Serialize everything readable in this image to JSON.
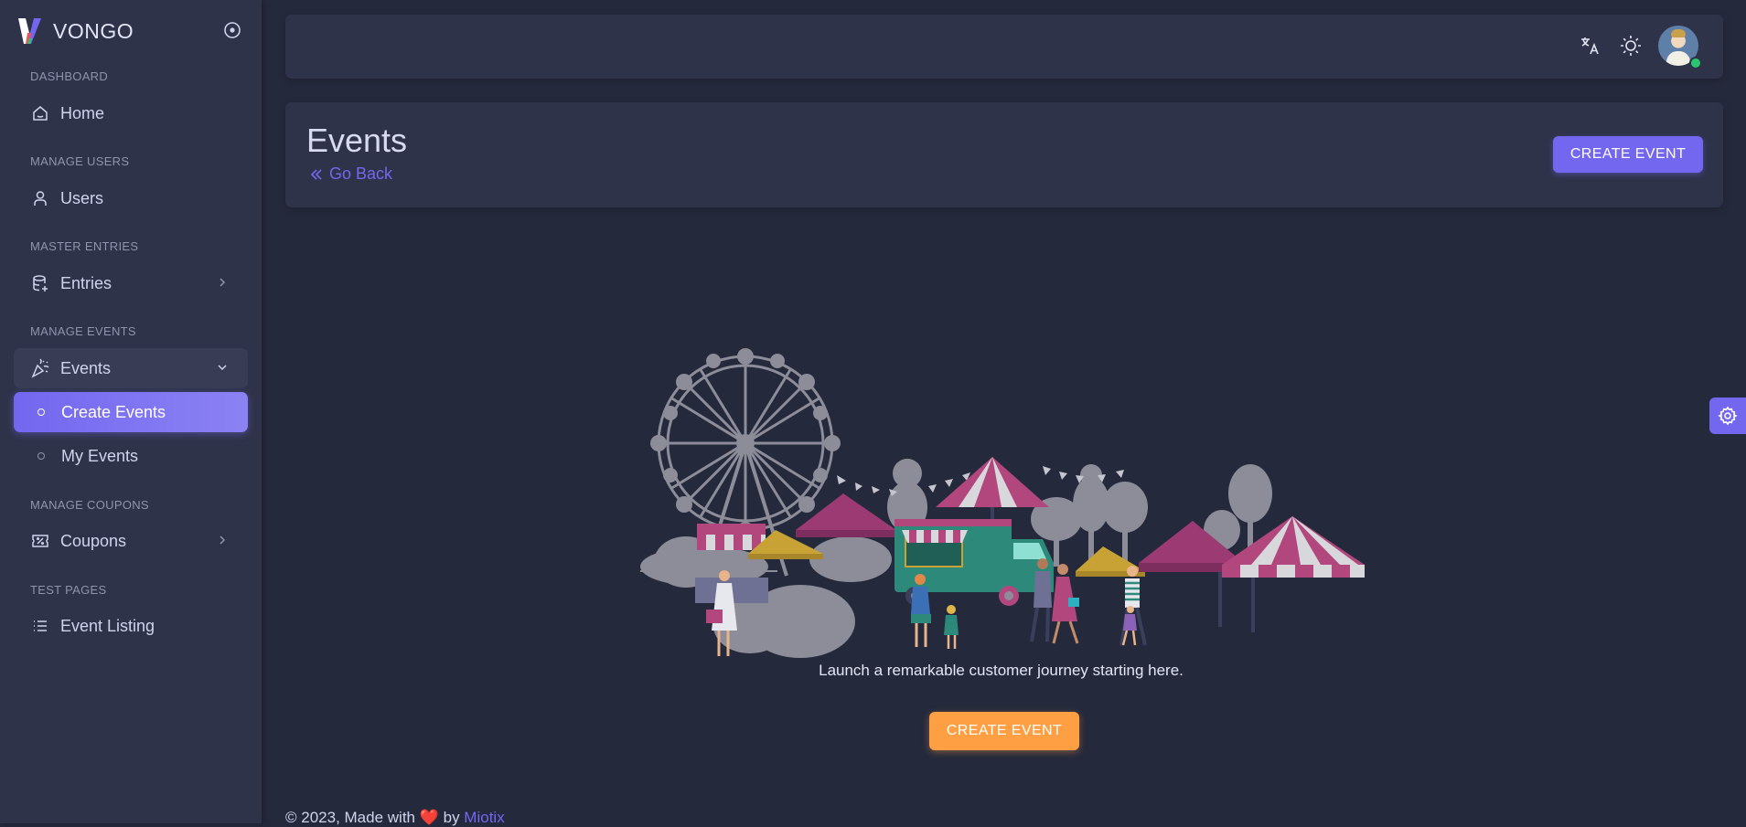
{
  "brand": {
    "name": "VONGO"
  },
  "sidebar": {
    "sections": [
      {
        "label": "DASHBOARD"
      },
      {
        "label": "MANAGE USERS"
      },
      {
        "label": "MASTER ENTRIES"
      },
      {
        "label": "MANAGE EVENTS"
      },
      {
        "label": "MANAGE COUPONS"
      },
      {
        "label": "TEST PAGES"
      }
    ],
    "items": [
      {
        "label": "Home",
        "icon": "smart-home-icon"
      },
      {
        "label": "Users",
        "icon": "user-icon"
      },
      {
        "label": "Entries",
        "icon": "database-plus-icon"
      },
      {
        "label": "Events",
        "icon": "confetti-icon",
        "expanded": true
      },
      {
        "label": "Create Events",
        "active": true
      },
      {
        "label": "My Events"
      },
      {
        "label": "Coupons",
        "icon": "ticket-icon"
      },
      {
        "label": "Event Listing",
        "icon": "list-icon"
      }
    ]
  },
  "topbar": {
    "icons": [
      "language-icon",
      "sun-icon",
      "avatar"
    ],
    "user_status": "online"
  },
  "header": {
    "title": "Events",
    "back_label": "Go Back",
    "create_button": "CREATE EVENT"
  },
  "empty_state": {
    "message": "Launch a remarkable customer journey starting here.",
    "button": "CREATE EVENT"
  },
  "footer": {
    "prefix": "© 2023, Made with ",
    "heart": "❤️",
    "by": " by ",
    "link": "Miotix"
  },
  "colors": {
    "primary": "#7367f0",
    "warning": "#ff9f43",
    "background": "#25293c",
    "surface": "#2f3349"
  }
}
